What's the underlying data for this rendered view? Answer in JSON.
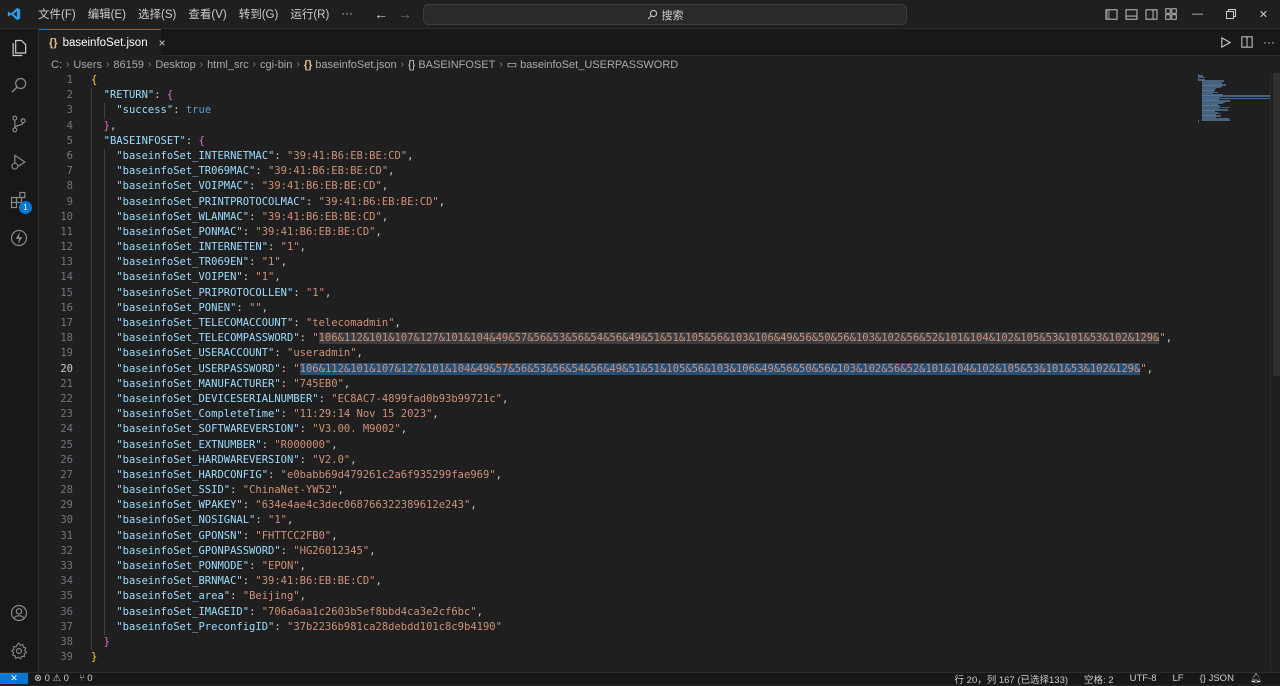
{
  "menu": [
    "文件(F)",
    "编辑(E)",
    "选择(S)",
    "查看(V)",
    "转到(G)",
    "运行(R)",
    "···"
  ],
  "nav": {
    "back": "←",
    "forward": "→"
  },
  "search": {
    "label": "搜索"
  },
  "tab": {
    "name": "baseinfoSet.json",
    "close": "×"
  },
  "breadcrumb": {
    "parts": [
      "C:",
      "Users",
      "86159",
      "Desktop",
      "html_src",
      "cgi-bin"
    ],
    "file": "baseinfoSet.json",
    "object": "BASEINFOSET",
    "field": "baseinfoSet_USERPASSWORD"
  },
  "editor": {
    "active_line": 20,
    "lines": [
      "{",
      "\"RETURN\": {",
      "\"success\": true",
      "},",
      "\"BASEINFOSET\": {",
      {
        "k": "baseinfoSet_INTERNETMAC",
        "v": "39:41:B6:EB:BE:CD"
      },
      {
        "k": "baseinfoSet_TR069MAC",
        "v": "39:41:B6:EB:BE:CD"
      },
      {
        "k": "baseinfoSet_VOIPMAC",
        "v": "39:41:B6:EB:BE:CD"
      },
      {
        "k": "baseinfoSet_PRINTPROTOCOLMAC",
        "v": "39:41:B6:EB:BE:CD"
      },
      {
        "k": "baseinfoSet_WLANMAC",
        "v": "39:41:B6:EB:BE:CD"
      },
      {
        "k": "baseinfoSet_PONMAC",
        "v": "39:41:B6:EB:BE:CD"
      },
      {
        "k": "baseinfoSet_INTERNETEN",
        "v": "1"
      },
      {
        "k": "baseinfoSet_TR069EN",
        "v": "1"
      },
      {
        "k": "baseinfoSet_VOIPEN",
        "v": "1"
      },
      {
        "k": "baseinfoSet_PRIPROTOCOLLEN",
        "v": "1"
      },
      {
        "k": "baseinfoSet_PONEN",
        "v": ""
      },
      {
        "k": "baseinfoSet_TELECOMACCOUNT",
        "v": "telecomadmin"
      },
      {
        "k": "baseinfoSet_TELECOMPASSWORD",
        "v": "106&112&101&107&127&101&104&49&57&56&53&56&54&56&49&51&51&105&56&103&106&49&56&50&56&103&102&56&52&101&104&102&105&53&101&53&102&129&",
        "hl": true
      },
      {
        "k": "baseinfoSet_USERACCOUNT",
        "v": "useradmin"
      },
      {
        "k": "baseinfoSet_USERPASSWORD",
        "v": "106&112&101&107&127&101&104&49&57&56&53&56&54&56&49&51&51&105&56&103&106&49&56&50&56&103&102&56&52&101&104&102&105&53&101&53&102&129&",
        "sel": true
      },
      {
        "k": "baseinfoSet_MANUFACTURER",
        "v": "745EB0"
      },
      {
        "k": "baseinfoSet_DEVICESERIALNUMBER",
        "v": "EC8AC7-4899fad0b93b99721c"
      },
      {
        "k": "baseinfoSet_CompleteTime",
        "v": "11:29:14 Nov 15 2023"
      },
      {
        "k": "baseinfoSet_SOFTWAREVERSION",
        "v": "V3.00. M9002"
      },
      {
        "k": "baseinfoSet_EXTNUMBER",
        "v": "R000000"
      },
      {
        "k": "baseinfoSet_HARDWAREVERSION",
        "v": "V2.0"
      },
      {
        "k": "baseinfoSet_HARDCONFIG",
        "v": "e0babb69d479261c2a6f935299fae969"
      },
      {
        "k": "baseinfoSet_SSID",
        "v": "ChinaNet-YW52"
      },
      {
        "k": "baseinfoSet_WPAKEY",
        "v": "634e4ae4c3dec068766322389612e243"
      },
      {
        "k": "baseinfoSet_NOSIGNAL",
        "v": "1"
      },
      {
        "k": "baseinfoSet_GPONSN",
        "v": "FHTTCC2FB0"
      },
      {
        "k": "baseinfoSet_GPONPASSWORD",
        "v": "HG26012345"
      },
      {
        "k": "baseinfoSet_PONMODE",
        "v": "EPON"
      },
      {
        "k": "baseinfoSet_BRNMAC",
        "v": "39:41:B6:EB:BE:CD"
      },
      {
        "k": "baseinfoSet_area",
        "v": "Beijing"
      },
      {
        "k": "baseinfoSet_IMAGEID",
        "v": "706a6aa1c2603b5ef8bbd4ca3e2cf6bc"
      },
      {
        "k": "baseinfoSet_PreconfigID",
        "v": "37b2236b981ca28debdd101c8c9b4190",
        "last": true
      },
      "}",
      "}"
    ]
  },
  "activity": {
    "extensions_badge": "1"
  },
  "status": {
    "problems": "⊗ 0 ⚠ 0",
    "ports": "⑂ 0",
    "position": "行 20，列 167 (已选择133)",
    "spaces": "空格: 2",
    "encoding": "UTF-8",
    "eol": "LF",
    "language": "{} JSON"
  },
  "colors": {
    "accent": "#0078d4",
    "selection": "#264f78",
    "key": "#9cdcfe",
    "string": "#ce9178",
    "keyword": "#569cd6"
  }
}
